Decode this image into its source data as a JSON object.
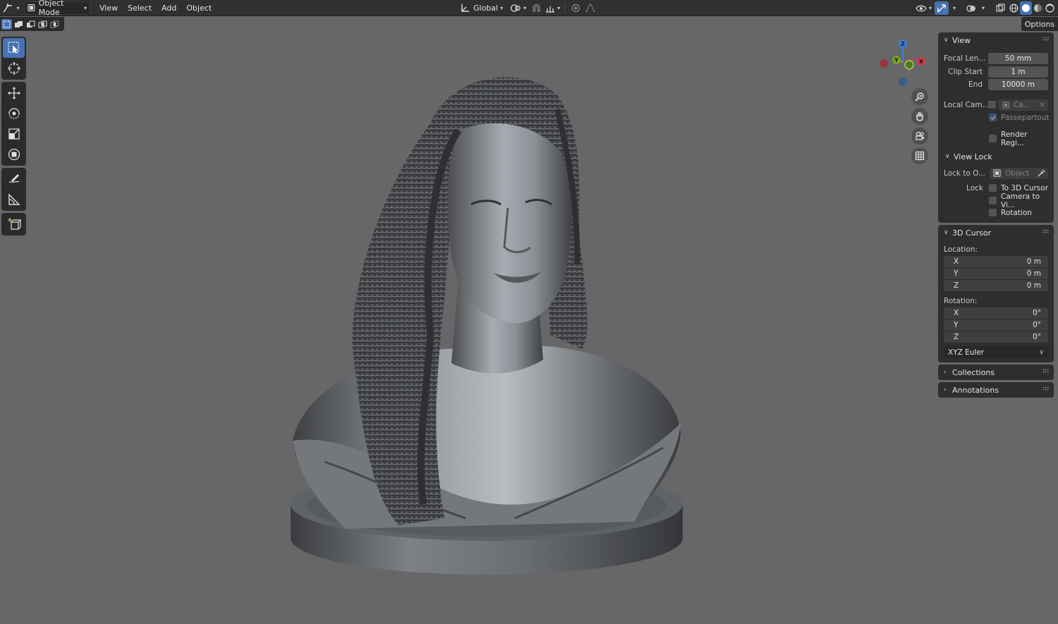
{
  "header": {
    "mode_label": "Object Mode",
    "menus": [
      "View",
      "Select",
      "Add",
      "Object"
    ],
    "orientation_label": "Global"
  },
  "options_label": "Options",
  "gizmo": {
    "x": "X",
    "y": "Y",
    "z": "Z"
  },
  "view_panel": {
    "title": "View",
    "focal_length_label": "Focal Len...",
    "focal_length_value": "50 mm",
    "clip_start_label": "Clip Start",
    "clip_start_value": "1 m",
    "clip_end_label": "End",
    "clip_end_value": "10000 m",
    "local_camera_label": "Local Cam...",
    "local_camera_value": "Ca...",
    "passepartout_label": "Passepartout",
    "render_region_label": "Render Regi...",
    "view_lock_title": "View Lock",
    "lock_to_object_label": "Lock to O...",
    "lock_to_object_placeholder": "Object",
    "lock_label": "Lock",
    "lock_to_cursor": "To 3D Cursor",
    "lock_camera": "Camera to Vi...",
    "lock_rotation": "Rotation"
  },
  "cursor_panel": {
    "title": "3D Cursor",
    "location_label": "Location:",
    "location": [
      {
        "axis": "X",
        "value": "0 m"
      },
      {
        "axis": "Y",
        "value": "0 m"
      },
      {
        "axis": "Z",
        "value": "0 m"
      }
    ],
    "rotation_label": "Rotation:",
    "rotation": [
      {
        "axis": "X",
        "value": "0°"
      },
      {
        "axis": "Y",
        "value": "0°"
      },
      {
        "axis": "Z",
        "value": "0°"
      }
    ],
    "rotation_mode": "XYZ Euler"
  },
  "collapsed_panels": [
    "Collections",
    "Annotations"
  ],
  "colors": {
    "accent": "#4772b3",
    "viewport_bg": "#676767",
    "axis_x": "#d33a4f",
    "axis_y": "#7aa321",
    "axis_z": "#3c7fd8"
  }
}
